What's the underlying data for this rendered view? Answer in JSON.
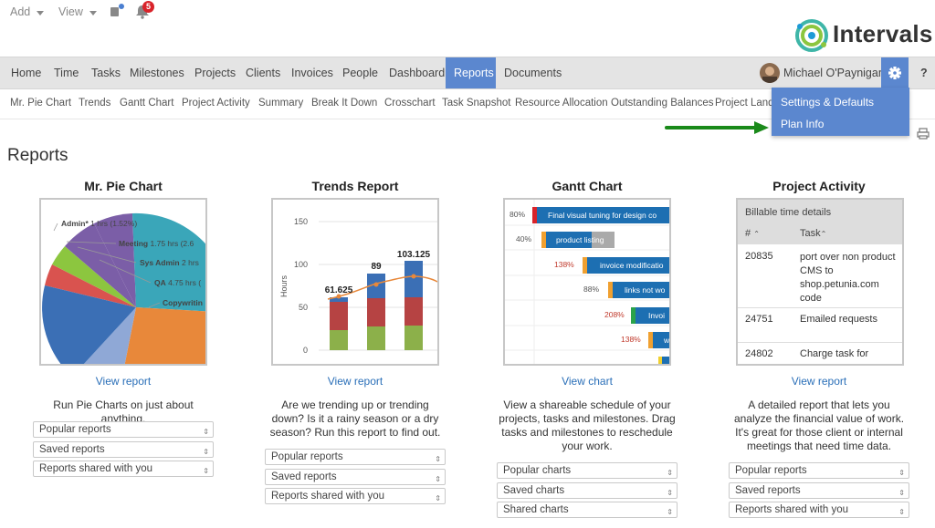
{
  "top": {
    "add_label": "Add",
    "view_label": "View",
    "notif_count": "5",
    "brand": "Intervals"
  },
  "nav": {
    "items": [
      "Home",
      "Time",
      "Tasks",
      "Milestones",
      "Projects",
      "Clients",
      "Invoices",
      "People",
      "Dashboard",
      "Reports",
      "Documents"
    ],
    "user_name": "Michael O'Paynigan",
    "help": "?"
  },
  "subnav": {
    "items": [
      "Mr. Pie Chart",
      "Trends",
      "Gantt Chart",
      "Project Activity",
      "Summary",
      "Break It Down",
      "Crosschart",
      "Task Snapshot",
      "Resource Allocation",
      "Outstanding Balances",
      "Project Lands"
    ]
  },
  "settings_menu": [
    "Settings & Defaults",
    "Plan Info"
  ],
  "page_title": "Reports",
  "cards": [
    {
      "title": "Mr. Pie Chart",
      "link": "View report",
      "desc": "Run Pie Charts on just about anything.",
      "selects": [
        "Popular reports",
        "Saved reports",
        "Reports shared with you"
      ]
    },
    {
      "title": "Trends Report",
      "link": "View report",
      "desc": "Are we trending up or trending down? Is it a rainy season or a dry season? Run this report to find out.",
      "selects": [
        "Popular reports",
        "Saved reports",
        "Reports shared with you"
      ]
    },
    {
      "title": "Gantt Chart",
      "link": "View chart",
      "desc": "View a shareable schedule of your projects, tasks and milestones. Drag tasks and milestones to reschedule your work.",
      "selects": [
        "Popular charts",
        "Saved charts",
        "Shared charts"
      ]
    },
    {
      "title": "Project Activity",
      "link": "View report",
      "desc": "A detailed report that lets you analyze the financial value of work. It's great for those client or internal meetings that need time data.",
      "selects": [
        "Popular reports",
        "Saved reports",
        "Reports shared with you"
      ]
    }
  ],
  "pie_labels": [
    {
      "name": "Admin*",
      "value": "1 hrs (1.52%)"
    },
    {
      "name": "Meeting",
      "value": "1.75 hrs (2.6"
    },
    {
      "name": "Sys Admin",
      "value": "2 hrs"
    },
    {
      "name": "QA",
      "value": "4.75 hrs ("
    },
    {
      "name": "Copywritin",
      "value": ""
    }
  ],
  "trends": {
    "ylabel": "Hours",
    "ticks": [
      "150",
      "100",
      "50",
      "0"
    ],
    "labels": [
      "61.625",
      "89",
      "103.125"
    ]
  },
  "gantt": {
    "rows": [
      {
        "pct": "80%",
        "label": "Final visual tuning for design co"
      },
      {
        "pct": "40%",
        "label": "product listing"
      },
      {
        "pct": "138%",
        "label": "invoice modificatio"
      },
      {
        "pct": "88%",
        "label": "links not wo"
      },
      {
        "pct": "208%",
        "label": "Invoi"
      },
      {
        "pct": "138%",
        "label": "w"
      }
    ]
  },
  "activity": {
    "header": "Billable time details",
    "col1": "#",
    "col2": "Task",
    "rows": [
      {
        "id": "20835",
        "task": "port over non product CMS to shop.petunia.com code"
      },
      {
        "id": "24751",
        "task": "Emailed requests"
      },
      {
        "id": "24802",
        "task": "Charge task for"
      }
    ]
  },
  "colors": {
    "accent": "#5b87cf",
    "link": "#2a6fb8",
    "arrow": "#1a8a1a",
    "badge": "#d9232a"
  }
}
